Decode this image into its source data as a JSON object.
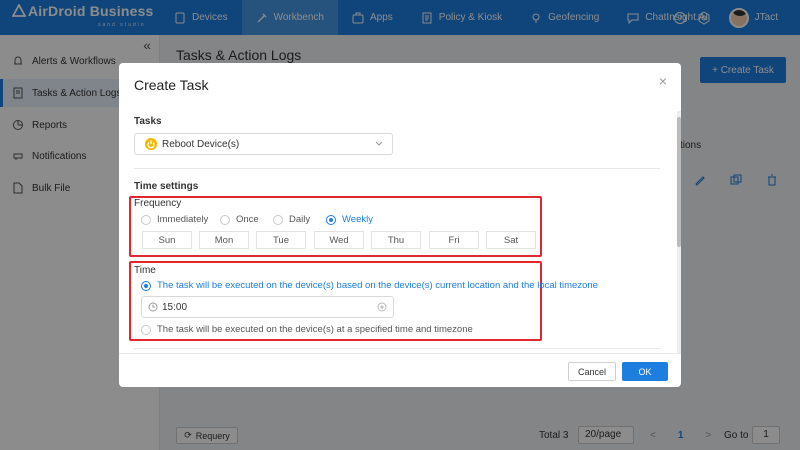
{
  "brand": {
    "name": "AirDroid Business",
    "tagline": "sand studio"
  },
  "nav": {
    "items": [
      {
        "label": "Devices",
        "icon": "device-icon"
      },
      {
        "label": "Workbench",
        "icon": "workbench-icon",
        "active": true
      },
      {
        "label": "Apps",
        "icon": "apps-icon"
      },
      {
        "label": "Policy & Kiosk",
        "icon": "policy-icon"
      },
      {
        "label": "Geofencing",
        "icon": "geofence-icon"
      },
      {
        "label": "ChatInsight.AI",
        "icon": "chat-icon"
      }
    ],
    "user": "JTact"
  },
  "sidebar": {
    "items": [
      {
        "label": "Alerts & Workflows",
        "icon": "alert-icon"
      },
      {
        "label": "Tasks & Action Logs",
        "icon": "tasks-icon",
        "active": true
      },
      {
        "label": "Reports",
        "icon": "reports-icon"
      },
      {
        "label": "Notifications",
        "icon": "notification-icon"
      },
      {
        "label": "Bulk File",
        "icon": "file-icon"
      }
    ]
  },
  "main": {
    "title": "Tasks & Action Logs",
    "create_label": "+ Create Task",
    "operations_label": "tions"
  },
  "footer": {
    "requery": "Requery",
    "total": "Total 3",
    "per_page": "20/page",
    "prev": "<",
    "page": "1",
    "next": ">",
    "goto_label": "Go to",
    "goto_value": "1"
  },
  "modal": {
    "title": "Create Task",
    "close": "×",
    "tasks_label": "Tasks",
    "task_value": "Reboot Device(s)",
    "time_settings_label": "Time settings",
    "frequency_label": "Frequency",
    "frequency_options": [
      "Immediately",
      "Once",
      "Daily",
      "Weekly"
    ],
    "frequency_selected": "Weekly",
    "days": [
      "Sun",
      "Mon",
      "Tue",
      "Wed",
      "Thu",
      "Fri",
      "Sat"
    ],
    "time_label": "Time",
    "time_option_local": "The task will be executed on the device(s) based on the device(s) current location and the local timezone",
    "time_value": "15:00",
    "time_option_specified": "The task will be executed on the device(s) at a specified time and timezone",
    "cancel": "Cancel",
    "ok": "OK"
  },
  "colors": {
    "primary": "#1e7ee0",
    "highlight": "#e0282e"
  }
}
